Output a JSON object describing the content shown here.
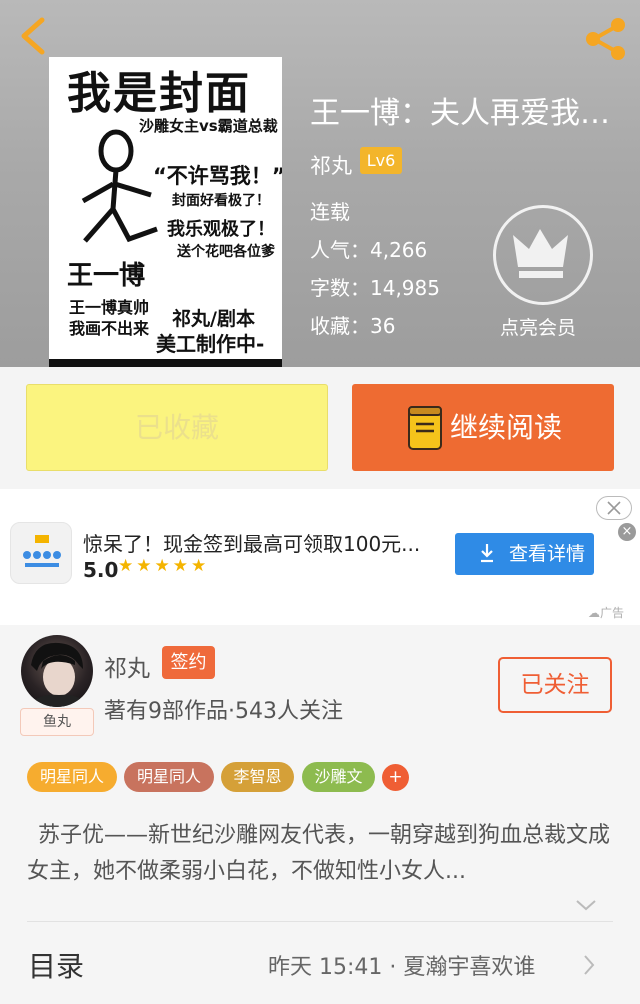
{
  "header": {
    "back_icon": "chevron-left-icon",
    "share_icon": "share-icon",
    "icon_color": "#f5a623"
  },
  "cover": {
    "title": "我是封面",
    "subtitle": "沙雕女主vs霸道总裁",
    "quote1": "“不许骂我！”",
    "quote2": "封面好看极了！",
    "quote3": "我乐观极了！",
    "quote4": "送个花吧各位爹",
    "name": "王一博",
    "line1": "王一博真帅",
    "line2": "我画不出来",
    "line3": "祁丸/剧本",
    "line4": "美工制作中-"
  },
  "book": {
    "title": "王一博：夫人再爱我…",
    "author": "祁丸",
    "level": "Lv6",
    "status": "连载",
    "popularity": "人气：4,266",
    "words": "字数：14,985",
    "favorites": "收藏：36",
    "vip_label": "点亮会员"
  },
  "actions": {
    "favorite_label": "已收藏",
    "read_label": "继续阅读"
  },
  "ad": {
    "title": "惊呆了！现金签到最高可领取100元...",
    "rating": "5.0",
    "stars": "★★★★★",
    "button_label": "查看详情",
    "tag": "广告",
    "close": "×"
  },
  "author_section": {
    "name": "祁丸",
    "badge": "签约",
    "avatar_tag": "鱼丸",
    "stats": "著有9部作品·543人关注",
    "follow_label": "已关注",
    "tags": [
      {
        "label": "明星同人",
        "color": "#f6ac2f"
      },
      {
        "label": "明星同人",
        "color": "#c8735e"
      },
      {
        "label": "李智恩",
        "color": "#d5a038"
      },
      {
        "label": "沙雕文",
        "color": "#8dbb4f"
      }
    ],
    "more_tag": "+",
    "description": "苏子优——新世纪沙雕网友代表，一朝穿越到狗血总裁文成女主，她不做柔弱小白花，不做知性小女人..."
  },
  "toc": {
    "label": "目录",
    "latest": "昨天 15:41 · 夏瀚宇喜欢谁"
  }
}
